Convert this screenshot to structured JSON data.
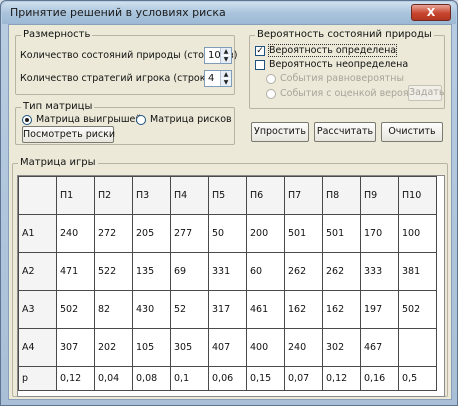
{
  "window": {
    "title": "Принятие решений в условиях риска",
    "close_label": "X"
  },
  "dimensions": {
    "legend": "Размерность",
    "nature_states_label": "Количество состояний природы (столбцов)",
    "nature_states_value": "10",
    "player_strategies_label": "Количество стратегий игрока (строк)",
    "player_strategies_value": "4"
  },
  "probabilities": {
    "legend": "Вероятность состояний природы",
    "known_label": "Вероятность определена",
    "known_checked": true,
    "unknown_label": "Вероятность неопределена",
    "unknown_checked": false,
    "equiprobable_label": "События равновероятны",
    "ordered_label": "События с оценкой вероятности",
    "set_button": "Задать"
  },
  "matrix_type": {
    "legend": "Тип матрицы",
    "payoff_label": "Матрица выигрышей",
    "risk_label": "Матрица рисков",
    "payoff_selected": true,
    "show_risks_button": "Посмотреть риски"
  },
  "actions": {
    "simplify": "Упростить",
    "calculate": "Рассчитать",
    "clear": "Очистить"
  },
  "matrix": {
    "legend": "Матрица игры",
    "columns": [
      "П1",
      "П2",
      "П3",
      "П4",
      "П5",
      "П6",
      "П7",
      "П8",
      "П9",
      "П10"
    ],
    "rows": [
      {
        "label": "A1",
        "values": [
          "240",
          "272",
          "205",
          "277",
          "50",
          "200",
          "501",
          "501",
          "170",
          "100"
        ]
      },
      {
        "label": "A2",
        "values": [
          "471",
          "522",
          "135",
          "69",
          "331",
          "60",
          "262",
          "262",
          "333",
          "381"
        ]
      },
      {
        "label": "A3",
        "values": [
          "502",
          "82",
          "430",
          "52",
          "317",
          "461",
          "162",
          "162",
          "197",
          "502"
        ]
      },
      {
        "label": "A4",
        "values": [
          "307",
          "202",
          "105",
          "305",
          "407",
          "400",
          "240",
          "302",
          "467"
        ]
      }
    ],
    "prob_row": {
      "label": "p",
      "values": [
        "0,12",
        "0,04",
        "0,08",
        "0,1",
        "0,06",
        "0,15",
        "0,07",
        "0,12",
        "0,16",
        "0,5"
      ]
    }
  }
}
